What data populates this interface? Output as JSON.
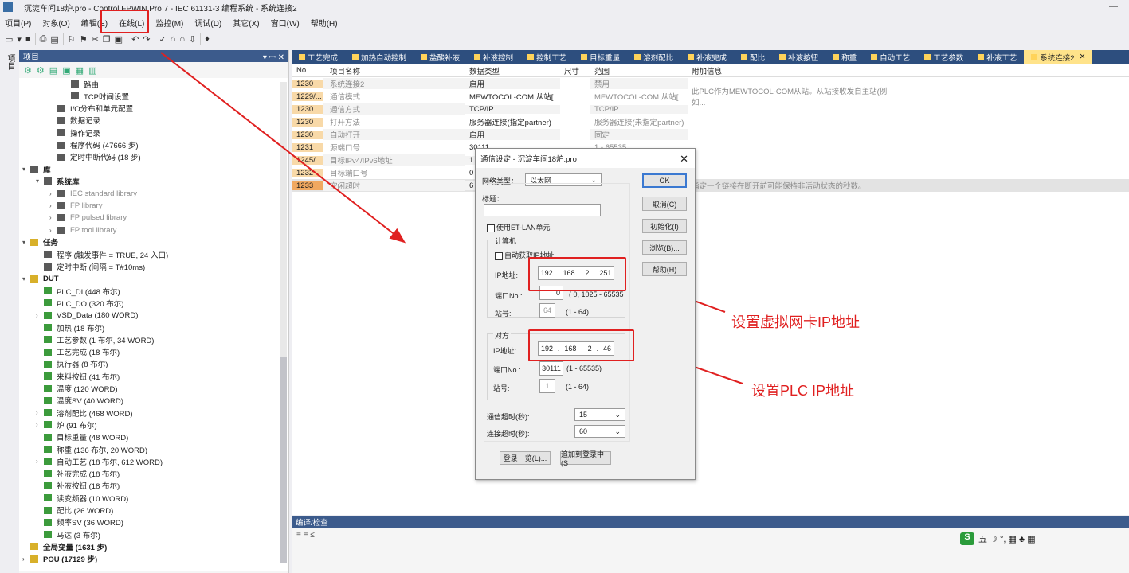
{
  "window": {
    "title": "沉淀车间18炉.pro - Control FPWIN Pro 7 - IEC 61131-3 编程系统 - 系统连接2",
    "minimize": "—"
  },
  "menu": [
    "项目(P)",
    "对象(O)",
    "编辑(E)",
    "在线(L)",
    "监控(M)",
    "调试(D)",
    "其它(X)",
    "窗口(W)",
    "帮助(H)"
  ],
  "left_strip": {
    "label": "项目"
  },
  "project_panel": {
    "header": "项目",
    "pin": "▾ ꟷ ✕",
    "tree": [
      {
        "label": "路由",
        "level": 3,
        "arrow": "",
        "icon": "grey",
        "dim": false,
        "bold": false
      },
      {
        "label": "TCP时间设置",
        "level": 3,
        "arrow": "",
        "icon": "grey",
        "dim": false,
        "bold": false
      },
      {
        "label": "I/O分布和单元配置",
        "level": 2,
        "arrow": "",
        "icon": "grey",
        "dim": false,
        "bold": false
      },
      {
        "label": "数据记录",
        "level": 2,
        "arrow": "",
        "icon": "grey",
        "dim": false,
        "bold": false
      },
      {
        "label": "操作记录",
        "level": 2,
        "arrow": "",
        "icon": "grey",
        "dim": false,
        "bold": false
      },
      {
        "label": "程序代码 (47666 步)",
        "level": 2,
        "arrow": "",
        "icon": "grey",
        "dim": false,
        "bold": false
      },
      {
        "label": "定时中断代码 (18 步)",
        "level": 2,
        "arrow": "",
        "icon": "grey",
        "dim": false,
        "bold": false
      },
      {
        "label": "库",
        "level": 0,
        "arrow": "▾",
        "icon": "grey",
        "dim": false,
        "bold": true
      },
      {
        "label": "系统库",
        "level": 1,
        "arrow": "▾",
        "icon": "grey",
        "dim": false,
        "bold": true
      },
      {
        "label": "IEC standard library",
        "level": 2,
        "arrow": "›",
        "icon": "grey",
        "dim": true,
        "bold": false
      },
      {
        "label": "FP library",
        "level": 2,
        "arrow": "›",
        "icon": "grey",
        "dim": true,
        "bold": false
      },
      {
        "label": "FP pulsed library",
        "level": 2,
        "arrow": "›",
        "icon": "grey",
        "dim": true,
        "bold": false
      },
      {
        "label": "FP tool library",
        "level": 2,
        "arrow": "›",
        "icon": "grey",
        "dim": true,
        "bold": false
      },
      {
        "label": "任务",
        "level": 0,
        "arrow": "▾",
        "icon": "y",
        "dim": false,
        "bold": true
      },
      {
        "label": "程序 (触发事件 = TRUE, 24 入口)",
        "level": 1,
        "arrow": "",
        "icon": "grey",
        "dim": false,
        "bold": false
      },
      {
        "label": "定时中断 (间隔 = T#10ms)",
        "level": 1,
        "arrow": "",
        "icon": "grey",
        "dim": false,
        "bold": false
      },
      {
        "label": "DUT",
        "level": 0,
        "arrow": "▾",
        "icon": "y",
        "dim": false,
        "bold": true
      },
      {
        "label": "PLC_DI (448 布尔)",
        "level": 1,
        "arrow": "",
        "icon": "g",
        "dim": false,
        "bold": false
      },
      {
        "label": "PLC_DO (320 布尔)",
        "level": 1,
        "arrow": "",
        "icon": "g",
        "dim": false,
        "bold": false
      },
      {
        "label": "VSD_Data (180 WORD)",
        "level": 1,
        "arrow": "›",
        "icon": "g",
        "dim": false,
        "bold": false
      },
      {
        "label": "加热 (18 布尔)",
        "level": 1,
        "arrow": "",
        "icon": "g",
        "dim": false,
        "bold": false
      },
      {
        "label": "工艺参数 (1 布尔, 34 WORD)",
        "level": 1,
        "arrow": "",
        "icon": "g",
        "dim": false,
        "bold": false
      },
      {
        "label": "工艺完成 (18 布尔)",
        "level": 1,
        "arrow": "",
        "icon": "g",
        "dim": false,
        "bold": false
      },
      {
        "label": "执行器 (8 布尔)",
        "level": 1,
        "arrow": "",
        "icon": "g",
        "dim": false,
        "bold": false
      },
      {
        "label": "来料按钮 (41 布尔)",
        "level": 1,
        "arrow": "",
        "icon": "g",
        "dim": false,
        "bold": false
      },
      {
        "label": "温度 (120 WORD)",
        "level": 1,
        "arrow": "",
        "icon": "g",
        "dim": false,
        "bold": false
      },
      {
        "label": "温度SV (40 WORD)",
        "level": 1,
        "arrow": "",
        "icon": "g",
        "dim": false,
        "bold": false
      },
      {
        "label": "溶剂配比 (468 WORD)",
        "level": 1,
        "arrow": "›",
        "icon": "g",
        "dim": false,
        "bold": false
      },
      {
        "label": "炉 (91 布尔)",
        "level": 1,
        "arrow": "›",
        "icon": "g",
        "dim": false,
        "bold": false
      },
      {
        "label": "目标重量 (48 WORD)",
        "level": 1,
        "arrow": "",
        "icon": "g",
        "dim": false,
        "bold": false
      },
      {
        "label": "称重 (136 布尔, 20 WORD)",
        "level": 1,
        "arrow": "",
        "icon": "g",
        "dim": false,
        "bold": false
      },
      {
        "label": "自动工艺 (18 布尔, 612 WORD)",
        "level": 1,
        "arrow": "›",
        "icon": "g",
        "dim": false,
        "bold": false
      },
      {
        "label": "补液完成 (18 布尔)",
        "level": 1,
        "arrow": "",
        "icon": "g",
        "dim": false,
        "bold": false
      },
      {
        "label": "补液按钮 (18 布尔)",
        "level": 1,
        "arrow": "",
        "icon": "g",
        "dim": false,
        "bold": false
      },
      {
        "label": "读变频器 (10 WORD)",
        "level": 1,
        "arrow": "",
        "icon": "g",
        "dim": false,
        "bold": false
      },
      {
        "label": "配比 (26 WORD)",
        "level": 1,
        "arrow": "",
        "icon": "g",
        "dim": false,
        "bold": false
      },
      {
        "label": "频率SV (36 WORD)",
        "level": 1,
        "arrow": "",
        "icon": "g",
        "dim": false,
        "bold": false
      },
      {
        "label": "马达 (3 布尔)",
        "level": 1,
        "arrow": "",
        "icon": "g",
        "dim": false,
        "bold": false
      },
      {
        "label": "全局变量 (1631 步)",
        "level": 0,
        "arrow": "",
        "icon": "y",
        "dim": false,
        "bold": true
      },
      {
        "label": "POU (17129 步)",
        "level": 0,
        "arrow": "›",
        "icon": "y",
        "dim": false,
        "bold": true
      }
    ]
  },
  "tabs": [
    {
      "label": "工艺完成",
      "active": false
    },
    {
      "label": "加热自动控制",
      "active": false
    },
    {
      "label": "盐酸补液",
      "active": false
    },
    {
      "label": "补液控制",
      "active": false
    },
    {
      "label": "控制工艺",
      "active": false
    },
    {
      "label": "目标重量",
      "active": false
    },
    {
      "label": "溶剂配比",
      "active": false
    },
    {
      "label": "补液完成",
      "active": false
    },
    {
      "label": "配比",
      "active": false
    },
    {
      "label": "补液按钮",
      "active": false
    },
    {
      "label": "称重",
      "active": false
    },
    {
      "label": "自动工艺",
      "active": false
    },
    {
      "label": "工艺参数",
      "active": false
    },
    {
      "label": "补液工艺",
      "active": false
    },
    {
      "label": "系统连接2",
      "active": true
    }
  ],
  "grid": {
    "columns": [
      "No",
      "项目名称",
      "数据类型",
      "尺寸",
      "范围",
      "附加信息"
    ],
    "rows": [
      {
        "no": "1230",
        "name": "系统连接2",
        "type": "启用",
        "size": "",
        "range": "禁用",
        "info": ""
      },
      {
        "no": "1229/...",
        "name": "通信模式",
        "type": "MEWTOCOL-COM 从站[...",
        "size": "",
        "range": "MEWTOCOL-COM 从站[...",
        "info": "此PLC作为MEWTOCOL-COM从站。从站接收发自主站(例如..."
      },
      {
        "no": "1230",
        "name": "通信方式",
        "type": "TCP/IP",
        "size": "",
        "range": "TCP/IP",
        "info": ""
      },
      {
        "no": "1230",
        "name": "打开方法",
        "type": "服务器连接(指定partner)",
        "size": "",
        "range": "服务器连接(未指定partner)",
        "info": ""
      },
      {
        "no": "1230",
        "name": "自动打开",
        "type": "启用",
        "size": "",
        "range": "固定",
        "info": ""
      },
      {
        "no": "1231",
        "name": "源端口号",
        "type": "30111",
        "size": "",
        "range": "1 - 65535",
        "info": ""
      },
      {
        "no": "1245/...",
        "name": "目标IPv4/IPv6地址",
        "type": "1",
        "size": "",
        "range": "",
        "info": ""
      },
      {
        "no": "1232",
        "name": "目标端口号",
        "type": "0",
        "size": "",
        "range": "",
        "info": ""
      },
      {
        "no": "1233",
        "name": "空闲超时",
        "type": "6",
        "size": "",
        "range": "",
        "info": "指定一个链接在断开前可能保持非活动状态的秒数。"
      }
    ]
  },
  "bottom_panel": {
    "header": "编译/检查",
    "tools": "≡ ≡ ≤"
  },
  "ime": {
    "label": "S",
    "text": "五 ☽ °, ▦ ♣ ▦"
  },
  "dialog": {
    "title": "通信设定 - 沉淀车间18炉.pro",
    "close": "✕",
    "network_type_label": "网络类型：",
    "network_type_value": "以太网",
    "caption_label": "标题：",
    "caption_value": "",
    "use_et_lan": "使用ET-LAN单元",
    "computer_group": "计算机",
    "auto_ip": "自动获取IP地址",
    "ip_label": "IP地址:",
    "computer_ip": [
      "192",
      "168",
      "2",
      "251"
    ],
    "port_label": "端口No.:",
    "computer_port": "0",
    "computer_port_range": "( 0, 1025 - 65535",
    "station_label": "站号:",
    "computer_station": "64",
    "station_range": "(1 - 64)",
    "partner_group": "对方",
    "partner_ip": [
      "192",
      "168",
      "2",
      "46"
    ],
    "partner_port": "30111",
    "partner_port_range": "(1 - 65535)",
    "partner_station": "1",
    "comm_timeout_label": "通信超时(秒):",
    "comm_timeout_value": "15",
    "conn_timeout_label": "连接超时(秒):",
    "conn_timeout_value": "60",
    "btn_ok": "OK",
    "btn_cancel": "取消(C)",
    "btn_init": "初始化(I)",
    "btn_browse": "浏览(B)...",
    "btn_help": "帮助(H)",
    "btn_login_list": "登录一览(L)...",
    "btn_add_login": "追加到登录中(S"
  },
  "annotations": {
    "virtual_nic": "设置虚拟网卡IP地址",
    "plc_ip": "设置PLC IP地址",
    "color": "#e02020"
  }
}
